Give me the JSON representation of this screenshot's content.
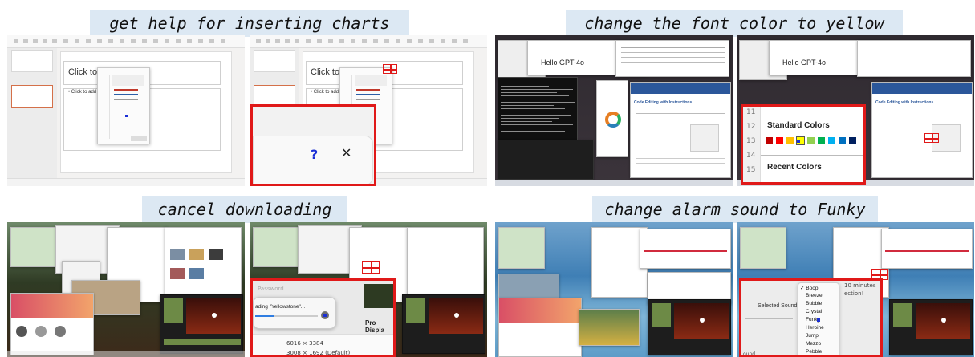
{
  "panels": [
    {
      "caption": "get help for inserting charts",
      "slide_title_placeholder": "Click to ac",
      "slide_bullet_placeholder": "• Click to add te",
      "zoom_help_glyph": "?",
      "zoom_close_glyph": "✕"
    },
    {
      "caption": "change the font color to yellow",
      "doc_heading": "Hello GPT-4o",
      "doc_heading_small": "Code Editing with Instructions",
      "zoom_line_numbers": [
        "11",
        "12",
        "13",
        "14",
        "15"
      ],
      "zoom_standard_colors_label": "Standard Colors",
      "zoom_recent_colors_label": "Recent Colors",
      "standard_colors": [
        "#c00000",
        "#ff0000",
        "#ffc000",
        "#ffff00",
        "#92d050",
        "#00b050",
        "#00b0f0",
        "#0070c0",
        "#002060"
      ],
      "recent_colors": [
        "#1f3864",
        "#c00000",
        "#ff0000",
        "#2e75b6",
        "#70ad47",
        "#ffc000",
        "#ed7d31",
        "#7030a0"
      ]
    },
    {
      "caption": "cancel downloading",
      "zoom_side_text": "Password",
      "zoom_download_text": "ading \"Yellowstone\"...",
      "zoom_display_label": "Pro Displa",
      "zoom_res_1": "6016 × 3384",
      "zoom_res_2": "3008 × 1692 (Default)"
    },
    {
      "caption": "change alarm sound to Funky",
      "zoom_label": "Selected Sound",
      "zoom_side_line1": "10 minutes",
      "zoom_side_line2": "ection!",
      "zoom_bottom_text": "ound",
      "zoom_sound_options": [
        "✓ Boop",
        "Breeze",
        "Bubble",
        "Crystal",
        "Funky",
        "Heroine",
        "Jump",
        "Mezzo",
        "Pebble"
      ]
    }
  ],
  "colors": {
    "highlight_red": "#e01919",
    "caption_bg": "#dce8f3",
    "cursor_blue": "#1a2fd6"
  }
}
